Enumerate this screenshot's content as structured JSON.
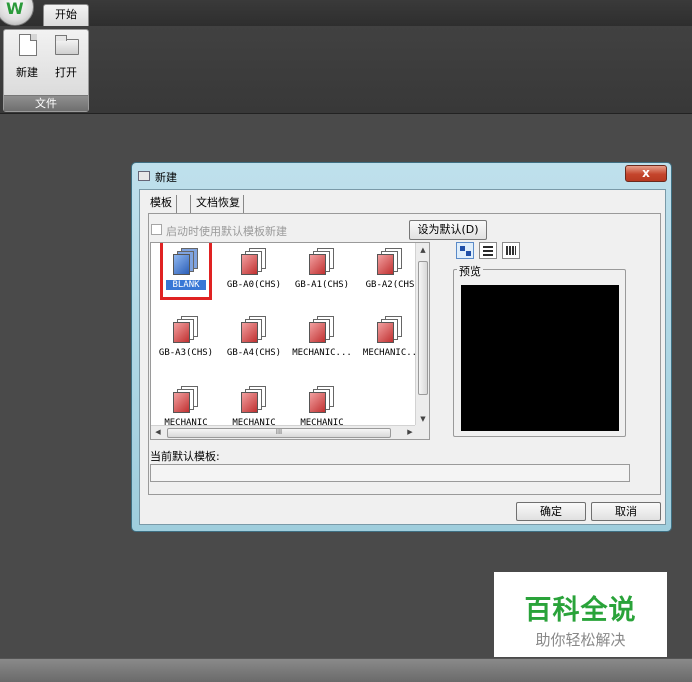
{
  "ribbon": {
    "tab_start": "开始",
    "group_file_label": "文件",
    "new_label": "新建",
    "open_label": "打开"
  },
  "dialog": {
    "title": "新建",
    "close_glyph": "x",
    "tabs": [
      "模板",
      "文档恢复"
    ],
    "startup_checkbox_label": "启动时使用默认模板新建",
    "set_default_label": "设为默认(D)",
    "templates": [
      {
        "label": "BLANK",
        "selected": true
      },
      {
        "label": "GB-A0(CHS)"
      },
      {
        "label": "GB-A1(CHS)"
      },
      {
        "label": "GB-A2(CHS"
      },
      {
        "label": "GB-A3(CHS)"
      },
      {
        "label": "GB-A4(CHS)"
      },
      {
        "label": "MECHANIC..."
      },
      {
        "label": "MECHANIC.."
      },
      {
        "label": "MECHANIC"
      },
      {
        "label": "MECHANIC"
      },
      {
        "label": "MECHANIC"
      }
    ],
    "hscroll_thumb_mark": "III",
    "preview_label": "预览",
    "current_default_label": "当前默认模板:",
    "current_default_value": "",
    "ok_label": "确定",
    "cancel_label": "取消"
  },
  "watermark": {
    "title": "百科全说",
    "subtitle": "助你轻松解决"
  },
  "colors": {
    "dialog_frame": "#9fcedd",
    "close_button": "#c4452c",
    "selection": "#3877d6",
    "highlight_box": "#e02222",
    "watermark_green": "#2aa33a"
  }
}
